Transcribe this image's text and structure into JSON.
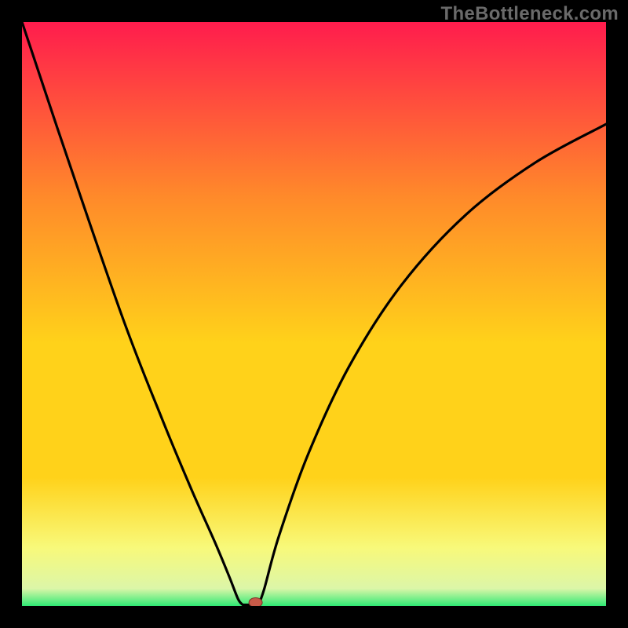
{
  "watermark": "TheBottleneck.com",
  "colors": {
    "background": "#000000",
    "gradient_top": "#ff1c4d",
    "gradient_mid_high": "#ff8a2a",
    "gradient_mid": "#ffd21a",
    "gradient_mid_low": "#f8f97a",
    "gradient_band": "#dcf6a8",
    "gradient_bottom": "#2fe974",
    "curve": "#000000",
    "marker_fill": "#c75a48",
    "marker_stroke": "#7a3328"
  },
  "chart_data": {
    "type": "line",
    "title": "",
    "xlabel": "",
    "ylabel": "",
    "xlim": [
      0,
      100
    ],
    "ylim": [
      0,
      100
    ],
    "left_curve": {
      "points": [
        [
          0,
          100
        ],
        [
          6,
          82
        ],
        [
          17,
          50
        ],
        [
          24,
          32
        ],
        [
          29,
          20
        ],
        [
          33,
          11
        ],
        [
          35.5,
          5
        ],
        [
          37,
          1.2
        ],
        [
          37.8,
          0.2
        ]
      ]
    },
    "floor": {
      "points": [
        [
          37.8,
          0.2
        ],
        [
          40.5,
          0.2
        ]
      ]
    },
    "right_curve": {
      "points": [
        [
          40.5,
          0.2
        ],
        [
          41.5,
          3
        ],
        [
          44,
          12
        ],
        [
          49,
          26
        ],
        [
          56,
          41
        ],
        [
          65,
          55
        ],
        [
          76,
          67
        ],
        [
          88,
          76
        ],
        [
          100,
          82.5
        ]
      ]
    },
    "marker": {
      "x": 40,
      "y": 0.6
    }
  }
}
